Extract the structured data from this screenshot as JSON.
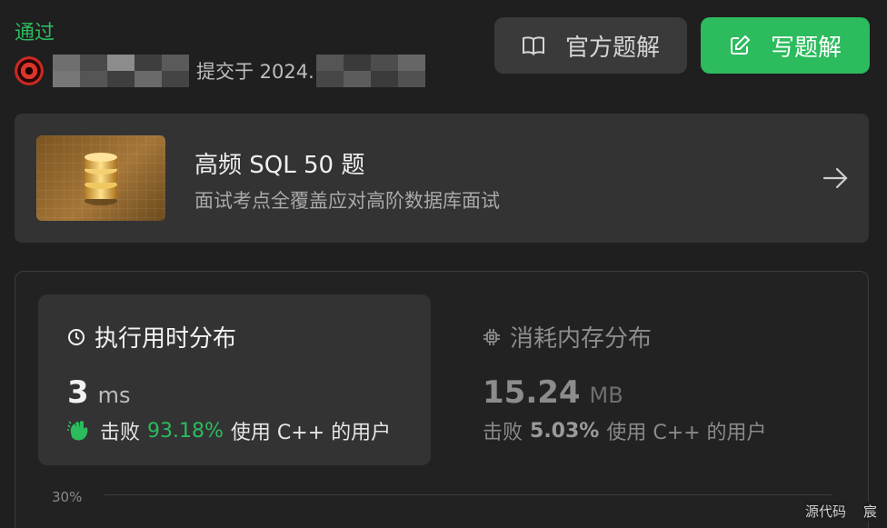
{
  "status": "通过",
  "submission": {
    "submitted_prefix": "提交于 2024."
  },
  "buttons": {
    "official_solution": "官方题解",
    "write_solution": "写题解"
  },
  "study_plan": {
    "title": "高频 SQL 50 题",
    "subtitle": "面试考点全覆盖应对高阶数据库面试"
  },
  "runtime": {
    "title": "执行用时分布",
    "value": "3",
    "unit": "ms",
    "beat_label": "击败",
    "beat_pct": "93.18%",
    "beat_suffix": "使用 C++ 的用户"
  },
  "memory": {
    "title": "消耗内存分布",
    "value": "15.24",
    "unit": "MB",
    "beat_label": "击败",
    "beat_pct": "5.03%",
    "beat_suffix": "使用 C++ 的用户"
  },
  "chart": {
    "axis_label": "30%"
  },
  "footer": {
    "source_code": "源代码",
    "partial": "宸"
  },
  "colors": {
    "accent_green": "#2cbb5d",
    "panel": "#333333",
    "background": "#1f1f1f"
  }
}
